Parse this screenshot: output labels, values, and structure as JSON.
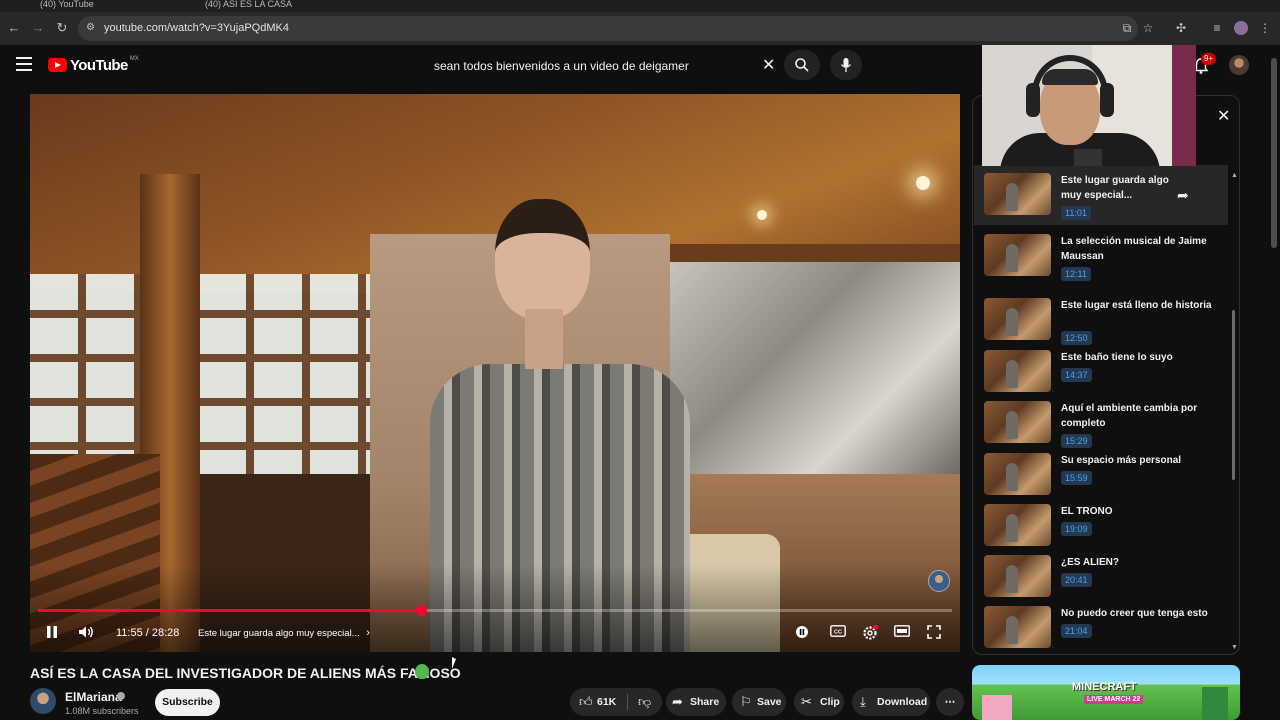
{
  "browser": {
    "tabs": [
      "(40) YouTube",
      "(40) ASÍ ES LA CASA"
    ],
    "url": "youtube.com/watch?v=3YujaPQdMK4"
  },
  "header": {
    "logo_text": "YouTube",
    "country_code": "MX",
    "search_query": "sean todos bienvenidos a un video de deigamer",
    "notification_count": "9+"
  },
  "player": {
    "current_time": "11:55",
    "duration": "28:28",
    "time_display": "11:55 / 28:28",
    "progress": 0.419,
    "chapter_label": "Este lugar guarda algo muy especial..."
  },
  "video": {
    "title": "ASÍ ES LA CASA DEL INVESTIGADOR DE ALIENS MÁS FAMOSO",
    "channel_name": "ElMariana",
    "subscribers": "1.08M subscribers",
    "subscribe_label": "Subscribe",
    "like_count": "61K",
    "share_label": "Share",
    "save_label": "Save",
    "clip_label": "Clip",
    "download_label": "Download"
  },
  "chapters": [
    {
      "title": "Este lugar guarda algo muy especial...",
      "time": "11:01",
      "active": true
    },
    {
      "title": "La selección musical de Jaime Maussan",
      "time": "12:11"
    },
    {
      "title": "Este lugar está lleno de historia",
      "time": "12:50"
    },
    {
      "title": "Este baño tiene lo suyo",
      "time": "14:37"
    },
    {
      "title": "Aquí el ambiente cambia por completo",
      "time": "15:29"
    },
    {
      "title": "Su espacio más personal",
      "time": "15:59"
    },
    {
      "title": "EL TRONO",
      "time": "19:09"
    },
    {
      "title": "¿ES ALIEN?",
      "time": "20:41"
    },
    {
      "title": "No puedo creer que tenga esto",
      "time": "21:04"
    }
  ],
  "ad": {
    "title": "MINECRAFT",
    "badge": "LIVE",
    "date": "MARCH 22"
  },
  "colors": {
    "accent_red": "#ff0033",
    "timestamp_blue": "#3ea6ff",
    "background": "#0f0f0f"
  }
}
